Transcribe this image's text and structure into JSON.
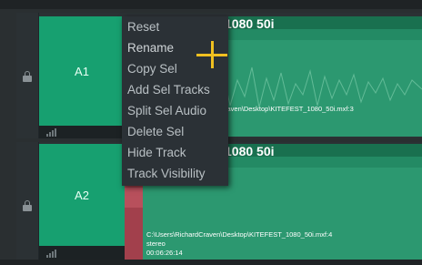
{
  "colors": {
    "track_header_green": "#17a070",
    "clip_green": "#2c9870",
    "menu_bg": "#2b3136",
    "menu_text": "#b9c0c4",
    "cursor_yellow": "#f0c020",
    "red_strip": "#a2404c"
  },
  "tracks": [
    {
      "label": "A1",
      "clip": {
        "title": "1080 50i",
        "path": "raven\\Desktop\\KITEFEST_1080_50i.mxf:3"
      }
    },
    {
      "label": "A2",
      "clip": {
        "title": "1080 50i",
        "path": "C:\\Users\\RichardCraven\\Desktop\\KITEFEST_1080_50i.mxf:4",
        "channels": "stereo",
        "duration": "00:06:26:14"
      }
    }
  ],
  "context_menu": {
    "items": [
      "Reset",
      "Rename",
      "Copy Sel",
      "Add Sel Tracks",
      "Split Sel Audio",
      "Delete Sel",
      "Hide Track",
      "Track Visibility"
    ],
    "hovered": "Rename"
  },
  "icons": {
    "lock": "lock-icon",
    "meter": "meter-icon",
    "cursor": "crosshair-cursor-icon"
  }
}
